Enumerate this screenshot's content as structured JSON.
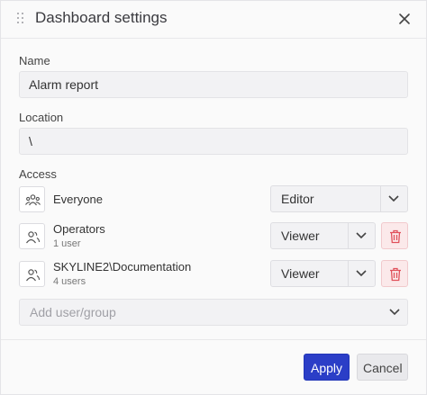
{
  "dialog": {
    "title": "Dashboard settings",
    "drag_icon": "drag-handle-icon",
    "close_icon": "close-icon"
  },
  "name_field": {
    "label": "Name",
    "value": "Alarm report"
  },
  "location_field": {
    "label": "Location",
    "value": "\\"
  },
  "access": {
    "label": "Access",
    "entries": [
      {
        "name": "Everyone",
        "sub": "",
        "role": "Editor",
        "icon": "group-icon"
      },
      {
        "name": "Operators",
        "sub": "1 user",
        "role": "Viewer",
        "icon": "users-icon"
      },
      {
        "name": "SKYLINE2\\Documentation",
        "sub": "4 users",
        "role": "Viewer",
        "icon": "users-icon"
      }
    ],
    "add_placeholder": "Add user/group"
  },
  "footer": {
    "apply_label": "Apply",
    "cancel_label": "Cancel"
  },
  "colors": {
    "primary": "#2b3ec7",
    "danger": "#e0505a"
  }
}
